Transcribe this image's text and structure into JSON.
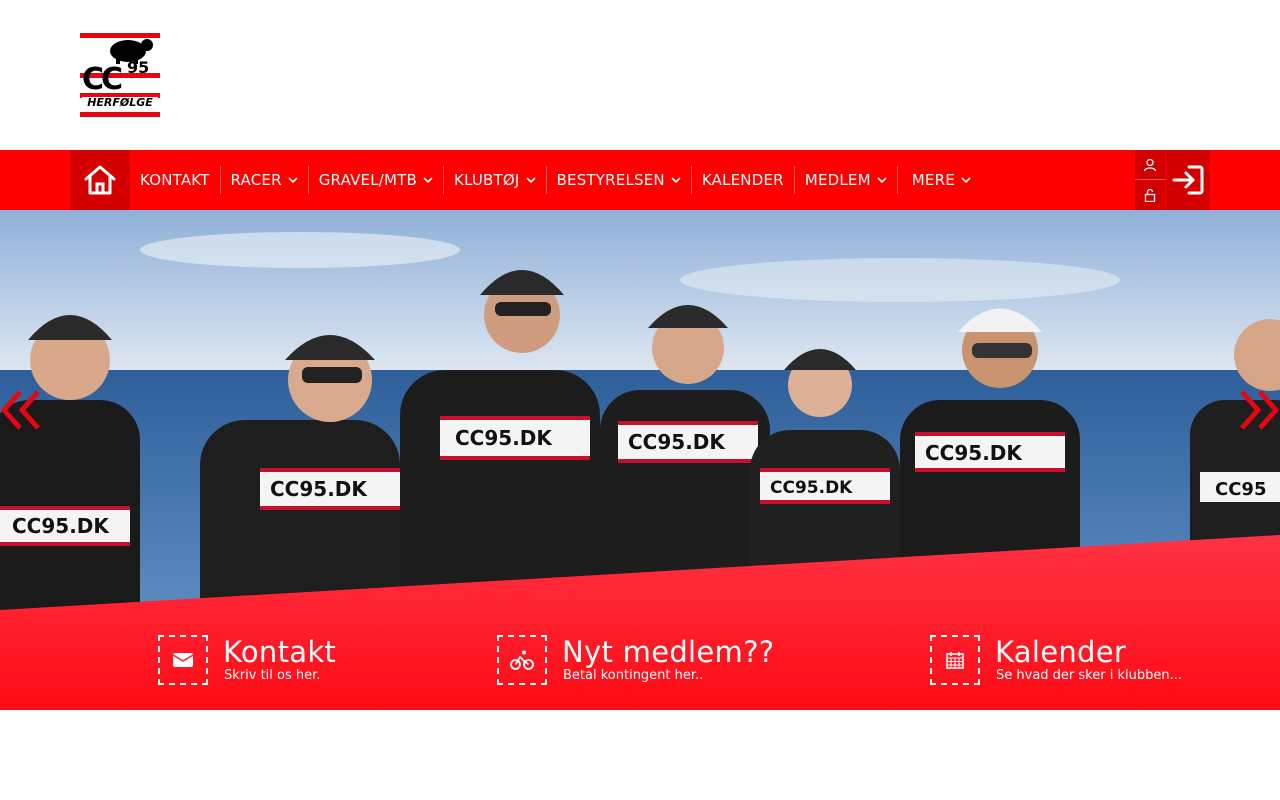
{
  "logo": {
    "top_text": "CC",
    "number": "95",
    "town": "HERFØLGE",
    "brand_red": "#e30613"
  },
  "nav": {
    "background": "#ff0000",
    "active_background": "#d40000",
    "home_icon": "home-icon",
    "items": [
      {
        "label": "KONTAKT",
        "has_dropdown": false
      },
      {
        "label": "RACER",
        "has_dropdown": true
      },
      {
        "label": "GRAVEL/MTB",
        "has_dropdown": true
      },
      {
        "label": "KLUBTØJ",
        "has_dropdown": true
      },
      {
        "label": "BESTYRELSEN",
        "has_dropdown": true
      },
      {
        "label": "KALENDER",
        "has_dropdown": false
      },
      {
        "label": "MEDLEM",
        "has_dropdown": true
      },
      {
        "label": "MERE",
        "has_dropdown": true
      }
    ],
    "user_icon": "user-icon",
    "lock_icon": "lock-icon",
    "login_icon": "login-icon"
  },
  "hero": {
    "jersey_text": "CC95.DK",
    "prev_icon": "double-chevron-left-icon",
    "next_icon": "double-chevron-right-icon"
  },
  "cta": {
    "band_color_top": "#ff3344",
    "band_color_bottom": "#ff0a14",
    "items": [
      {
        "icon": "envelope-icon",
        "title": "Kontakt",
        "subtitle": "Skriv til os her."
      },
      {
        "icon": "bicycle-icon",
        "title": "Nyt medlem??",
        "subtitle": "Betal kontingent her.."
      },
      {
        "icon": "calendar-icon",
        "title": "Kalender",
        "subtitle": "Se hvad der sker i klubben..."
      }
    ]
  }
}
